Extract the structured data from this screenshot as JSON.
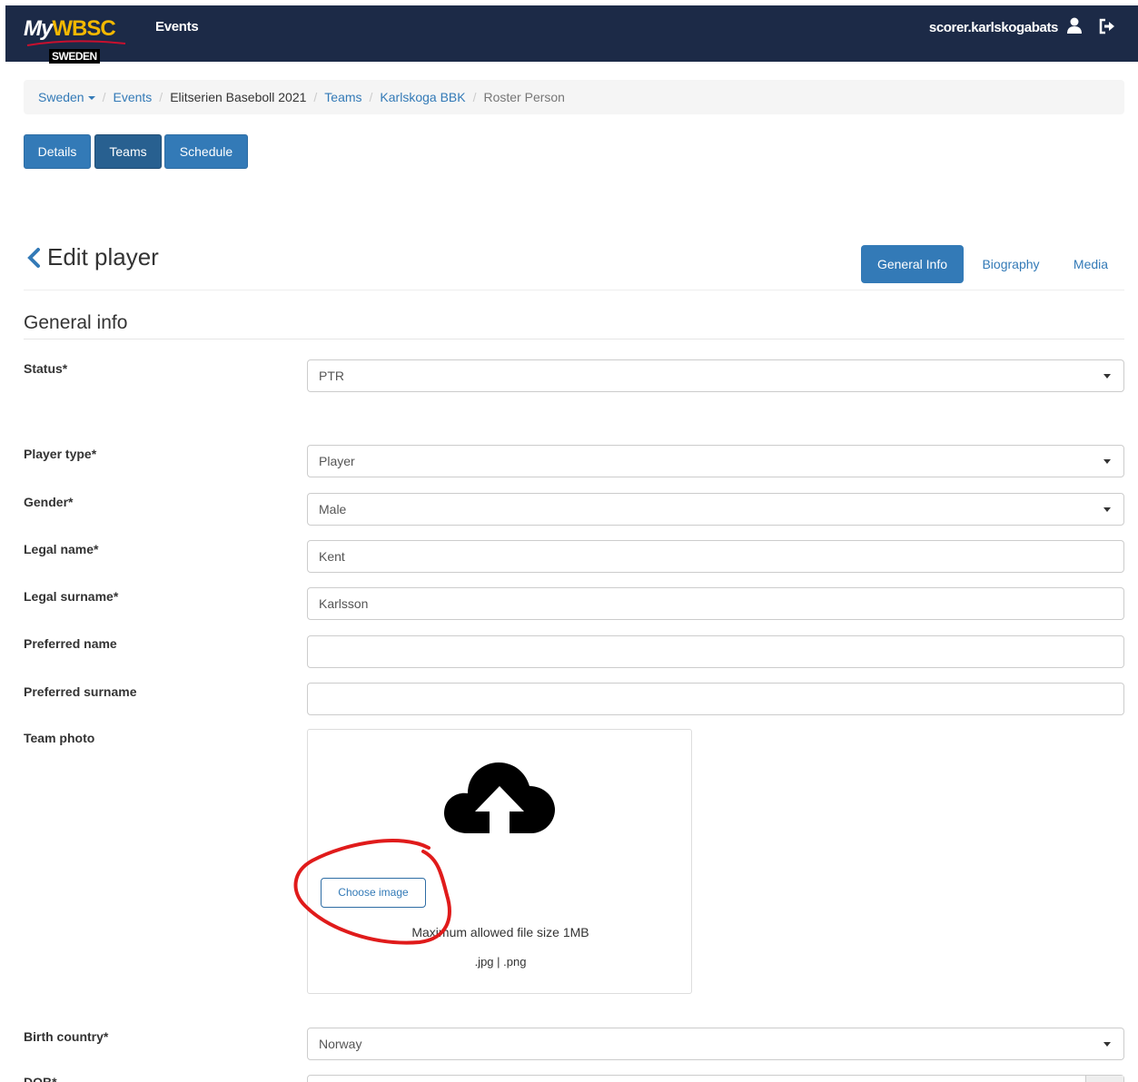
{
  "navbar": {
    "logo_text_prefix": "My",
    "logo_text_brand": "WBSC",
    "logo_badge": "SWEDEN",
    "events_label": "Events",
    "username": "scorer.karlskogabats"
  },
  "breadcrumb": {
    "items": [
      "Sweden",
      "Events",
      "Elitserien Baseboll 2021",
      "Teams",
      "Karlskoga BBK",
      "Roster Person"
    ]
  },
  "buttons": {
    "details": "Details",
    "teams": "Teams",
    "schedule": "Schedule"
  },
  "page": {
    "title": "Edit player",
    "tabs": [
      "General Info",
      "Biography",
      "Media"
    ],
    "section_title": "General info"
  },
  "form": {
    "status": {
      "label": "Status*",
      "value": "PTR"
    },
    "player_type": {
      "label": "Player type*",
      "value": "Player"
    },
    "gender": {
      "label": "Gender*",
      "value": "Male"
    },
    "legal_name": {
      "label": "Legal name*",
      "value": "Kent"
    },
    "legal_surname": {
      "label": "Legal surname*",
      "value": "Karlsson"
    },
    "preferred_name": {
      "label": "Preferred name",
      "value": ""
    },
    "preferred_surname": {
      "label": "Preferred surname",
      "value": ""
    },
    "team_photo": {
      "label": "Team photo",
      "choose_button": "Choose image",
      "max_size_note": "Maximum allowed file size 1MB",
      "formats_note": ".jpg | .png"
    },
    "birth_country": {
      "label": "Birth country*",
      "value": "Norway"
    },
    "dob": {
      "label": "DOB*"
    }
  },
  "colors": {
    "navbar_bg": "#1c2a47",
    "primary": "#337ab7",
    "annotation": "#e01b1b"
  }
}
